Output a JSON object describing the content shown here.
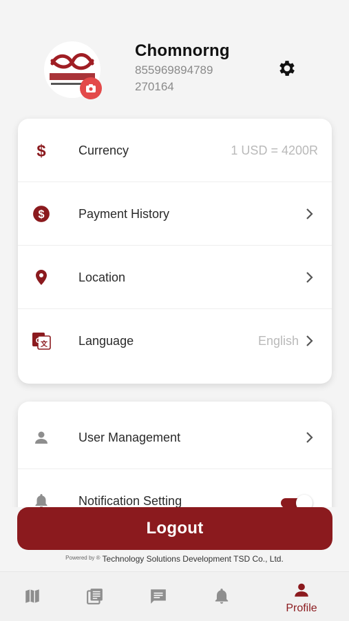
{
  "profile": {
    "name": "Chomnorng",
    "phone_line1": "855969894789",
    "phone_line2": "270164",
    "avatar_icon": "company-logo-icon",
    "camera_icon": "camera-icon",
    "settings_icon": "gear-icon"
  },
  "menu_main": [
    {
      "icon": "dollar-icon",
      "label": "Currency",
      "value": "1 USD = 4200R",
      "chevron": false
    },
    {
      "icon": "payment-history-icon",
      "label": "Payment History",
      "value": "",
      "chevron": true
    },
    {
      "icon": "location-pin-icon",
      "label": "Location",
      "value": "",
      "chevron": true
    },
    {
      "icon": "translate-icon",
      "label": "Language",
      "value": "English",
      "chevron": true
    }
  ],
  "menu_secondary": [
    {
      "icon": "user-icon",
      "label": "User Management",
      "chevron": true
    },
    {
      "icon": "bell-icon",
      "label": "Notification Setting",
      "toggle_on": true
    }
  ],
  "logout_label": "Logout",
  "footer": {
    "powered_prefix": "Powered by ®",
    "company": "Technology Solutions Development TSD Co., Ltd."
  },
  "tabs": [
    {
      "icon": "map-icon",
      "label": ""
    },
    {
      "icon": "news-icon",
      "label": ""
    },
    {
      "icon": "chat-icon",
      "label": ""
    },
    {
      "icon": "bell-icon",
      "label": ""
    },
    {
      "icon": "person-icon",
      "label": "Profile",
      "active": true
    }
  ],
  "colors": {
    "brand": "#8b1a1e",
    "badge": "#e34a4a",
    "muted_text": "#b9b9b9",
    "inactive_icon": "#8e8e8e"
  }
}
